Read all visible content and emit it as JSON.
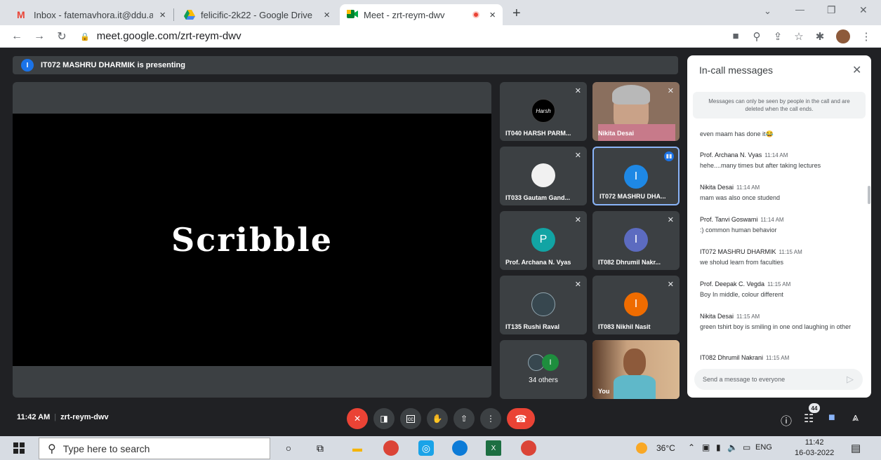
{
  "browser": {
    "tabs": [
      {
        "label": "Inbox - fatemavhora.it@ddu.ac.in",
        "close": "×"
      },
      {
        "label": "felicific-2k22 - Google Drive",
        "close": "×"
      },
      {
        "label": "Meet - zrt-reym-dwv",
        "close": "×"
      }
    ],
    "new_tab": "+",
    "window_controls": [
      "⌄",
      "—",
      "❐",
      "✕"
    ],
    "url": "meet.google.com/zrt-reym-dwv"
  },
  "meet": {
    "presenting_banner": "IT072 MASHRU DHARMIK is presenting",
    "presenter_initial": "I",
    "screen_text": "Scribble",
    "tiles": [
      {
        "name": "IT040 HARSH PARM...",
        "initial": ""
      },
      {
        "name": "Nikita Desai",
        "initial": ""
      },
      {
        "name": "IT033 Gautam Gand...",
        "initial": ""
      },
      {
        "name": "IT072 MASHRU DHA...",
        "initial": "I"
      },
      {
        "name": "Prof. Archana N. Vyas",
        "initial": "P"
      },
      {
        "name": "IT082 Dhrumil Nakr...",
        "initial": "I"
      },
      {
        "name": "IT135 Rushi Raval",
        "initial": ""
      },
      {
        "name": "IT083 Nikhil Nasit",
        "initial": "I"
      },
      {
        "name": "34 others",
        "initial": "I"
      },
      {
        "name": "You",
        "initial": ""
      }
    ],
    "time": "11:42 AM",
    "meeting_code": "zrt-reym-dwv",
    "participant_count": "44"
  },
  "chat": {
    "title": "In-call messages",
    "notice": "Messages can only be seen by people in the call and are deleted when the call ends.",
    "partial_message": "even maam has done it😂",
    "messages": [
      {
        "sender": "Prof. Archana N. Vyas",
        "time": "11:14 AM",
        "text": "hehe....many times but after taking lectures"
      },
      {
        "sender": "Nikita Desai",
        "time": "11:14 AM",
        "text": "mam was also once studend"
      },
      {
        "sender": "Prof. Tanvi Goswami",
        "time": "11:14 AM",
        "text": ":) common human behavior"
      },
      {
        "sender": "IT072 MASHRU DHARMIK",
        "time": "11:15 AM",
        "text": "we sholud learn from faculties"
      },
      {
        "sender": "Prof. Deepak C. Vegda",
        "time": "11:15 AM",
        "text": "Boy In middle, colour different"
      },
      {
        "sender": "Nikita Desai",
        "time": "11:15 AM",
        "text": "green tshirt boy is smiling in one ond laughing in other"
      },
      {
        "sender": "IT082 Dhrumil Nakrani",
        "time": "11:15 AM",
        "text": ""
      }
    ],
    "input_placeholder": "Send a message to everyone"
  },
  "taskbar": {
    "search_placeholder": "Type here to search",
    "weather": "36°C",
    "language": "ENG",
    "clock_time": "11:42",
    "clock_date": "16-03-2022"
  }
}
